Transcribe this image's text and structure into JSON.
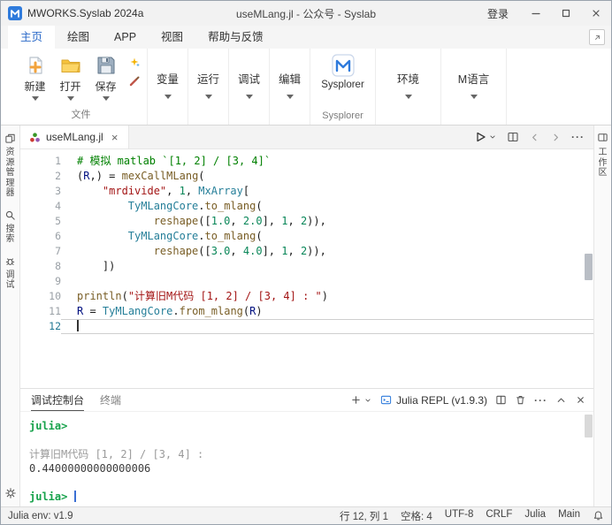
{
  "colors": {
    "accent_blue": "#2968c8",
    "prompt_green": "#17a24b",
    "comment_green": "#008000",
    "string_red": "#a31515",
    "number_green": "#098658",
    "function_gold": "#795e26",
    "variable_blue": "#001080",
    "type_teal": "#267f99"
  },
  "icons": {
    "mworks-logo": "blue M tile",
    "new": "page with gold plus",
    "open": "yellow folder",
    "save": "floppy disk",
    "wand": "sparkles",
    "brush": "brush",
    "chevron-down": "▾",
    "sysplorer": "M tile",
    "run": "▷",
    "split-editor": "split rectangle",
    "back": "‹",
    "forward": "›",
    "more": "···",
    "close": "×",
    "minimize": "—",
    "maximize": "▢",
    "plus": "+",
    "repl": "▸ in box",
    "trash": "trash can",
    "chevron-up": "^",
    "bell": "bell",
    "gear": "gear",
    "search": "magnifier",
    "explorer": "pages",
    "debug": "bug",
    "workspace": "panel grid"
  },
  "titlebar": {
    "app_title": "MWORKS.Syslab 2024a",
    "doc_title": "useMLang.jl - 公众号 - Syslab",
    "login_label": "登录"
  },
  "ribbon": {
    "tabs": [
      {
        "label": "主页",
        "active": true
      },
      {
        "label": "绘图",
        "active": false
      },
      {
        "label": "APP",
        "active": false
      },
      {
        "label": "视图",
        "active": false
      },
      {
        "label": "帮助与反馈",
        "active": false
      }
    ],
    "file_group": {
      "label": "文件",
      "buttons": [
        {
          "label": "新建"
        },
        {
          "label": "打开"
        },
        {
          "label": "保存"
        }
      ]
    },
    "dropdowns": [
      {
        "label": "变量"
      },
      {
        "label": "运行"
      },
      {
        "label": "调试"
      },
      {
        "label": "编辑"
      }
    ],
    "sysplorer": {
      "label": "Sysplorer",
      "group_label": "Sysplorer"
    },
    "dropdowns2": [
      {
        "label": "环境"
      },
      {
        "label": "M语言"
      }
    ]
  },
  "activity_bar": {
    "items": [
      {
        "label": "资源管理器"
      },
      {
        "label": "搜索"
      },
      {
        "label": "调试"
      }
    ]
  },
  "right_bar": {
    "label": "工作区"
  },
  "editor": {
    "tab_label": "useMLang.jl",
    "active_line": 12,
    "lines": [
      {
        "n": 1,
        "tokens": [
          {
            "t": "# 模拟 matlab `[1, 2] / [3, 4]`",
            "c": "comment"
          }
        ]
      },
      {
        "n": 2,
        "tokens": [
          {
            "t": "(",
            "c": "plain"
          },
          {
            "t": "R",
            "c": "var"
          },
          {
            "t": ",) = ",
            "c": "plain"
          },
          {
            "t": "mexCallMLang",
            "c": "fn"
          },
          {
            "t": "(",
            "c": "plain"
          }
        ]
      },
      {
        "n": 3,
        "tokens": [
          {
            "t": "    ",
            "c": "plain"
          },
          {
            "t": "\"mrdivide\"",
            "c": "str"
          },
          {
            "t": ", ",
            "c": "plain"
          },
          {
            "t": "1",
            "c": "num"
          },
          {
            "t": ", ",
            "c": "plain"
          },
          {
            "t": "MxArray",
            "c": "type"
          },
          {
            "t": "[",
            "c": "plain"
          }
        ]
      },
      {
        "n": 4,
        "tokens": [
          {
            "t": "        ",
            "c": "plain"
          },
          {
            "t": "TyMLangCore",
            "c": "type"
          },
          {
            "t": ".",
            "c": "plain"
          },
          {
            "t": "to_mlang",
            "c": "fn"
          },
          {
            "t": "(",
            "c": "plain"
          }
        ]
      },
      {
        "n": 5,
        "tokens": [
          {
            "t": "            ",
            "c": "plain"
          },
          {
            "t": "reshape",
            "c": "fn"
          },
          {
            "t": "([",
            "c": "plain"
          },
          {
            "t": "1.0",
            "c": "num"
          },
          {
            "t": ", ",
            "c": "plain"
          },
          {
            "t": "2.0",
            "c": "num"
          },
          {
            "t": "], ",
            "c": "plain"
          },
          {
            "t": "1",
            "c": "num"
          },
          {
            "t": ", ",
            "c": "plain"
          },
          {
            "t": "2",
            "c": "num"
          },
          {
            "t": ")),",
            "c": "plain"
          }
        ]
      },
      {
        "n": 6,
        "tokens": [
          {
            "t": "        ",
            "c": "plain"
          },
          {
            "t": "TyMLangCore",
            "c": "type"
          },
          {
            "t": ".",
            "c": "plain"
          },
          {
            "t": "to_mlang",
            "c": "fn"
          },
          {
            "t": "(",
            "c": "plain"
          }
        ]
      },
      {
        "n": 7,
        "tokens": [
          {
            "t": "            ",
            "c": "plain"
          },
          {
            "t": "reshape",
            "c": "fn"
          },
          {
            "t": "([",
            "c": "plain"
          },
          {
            "t": "3.0",
            "c": "num"
          },
          {
            "t": ", ",
            "c": "plain"
          },
          {
            "t": "4.0",
            "c": "num"
          },
          {
            "t": "], ",
            "c": "plain"
          },
          {
            "t": "1",
            "c": "num"
          },
          {
            "t": ", ",
            "c": "plain"
          },
          {
            "t": "2",
            "c": "num"
          },
          {
            "t": ")),",
            "c": "plain"
          }
        ]
      },
      {
        "n": 8,
        "tokens": [
          {
            "t": "    ])",
            "c": "plain"
          }
        ]
      },
      {
        "n": 9,
        "tokens": []
      },
      {
        "n": 10,
        "tokens": [
          {
            "t": "println",
            "c": "fn"
          },
          {
            "t": "(",
            "c": "plain"
          },
          {
            "t": "\"计算旧M代码 [1, 2] / [3, 4] : \"",
            "c": "str"
          },
          {
            "t": ")",
            "c": "plain"
          }
        ]
      },
      {
        "n": 11,
        "tokens": [
          {
            "t": "R",
            "c": "var"
          },
          {
            "t": " = ",
            "c": "plain"
          },
          {
            "t": "TyMLangCore",
            "c": "type"
          },
          {
            "t": ".",
            "c": "plain"
          },
          {
            "t": "from_mlang",
            "c": "fn"
          },
          {
            "t": "(",
            "c": "plain"
          },
          {
            "t": "R",
            "c": "var"
          },
          {
            "t": ")",
            "c": "plain"
          }
        ]
      },
      {
        "n": 12,
        "tokens": []
      }
    ]
  },
  "panel": {
    "tabs": [
      {
        "label": "调试控制台",
        "active": true
      },
      {
        "label": "终端",
        "active": false
      }
    ],
    "repl_selector": "Julia REPL (v1.9.3)",
    "console": {
      "lines": [
        {
          "kind": "prompt",
          "text": "julia>"
        },
        {
          "kind": "blank",
          "text": ""
        },
        {
          "kind": "muted",
          "text": "计算旧M代码 [1, 2] / [3, 4] : "
        },
        {
          "kind": "output",
          "text": "0.44000000000000006"
        },
        {
          "kind": "blank",
          "text": ""
        },
        {
          "kind": "prompt",
          "text": "julia> ",
          "cursor": true
        }
      ]
    }
  },
  "statusbar": {
    "left": "Julia env: v1.9",
    "right": [
      "行 12, 列 1",
      "空格: 4",
      "UTF-8",
      "CRLF",
      "Julia",
      "Main"
    ]
  }
}
